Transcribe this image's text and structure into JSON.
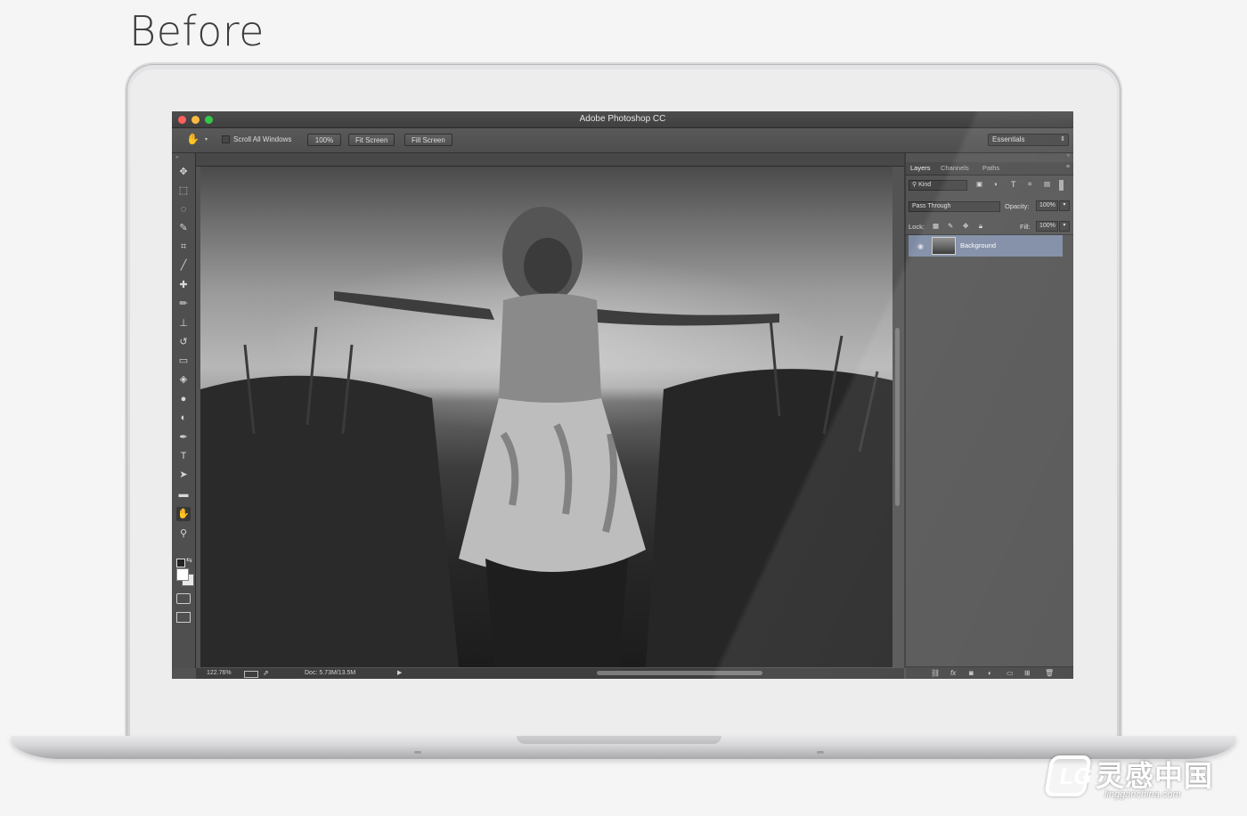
{
  "heading": "Before",
  "window": {
    "title": "Adobe Photoshop CC",
    "traffic_lights": {
      "close": "#fc605c",
      "minimize": "#fdbc40",
      "zoom": "#34c84a"
    }
  },
  "options_bar": {
    "tool_icon": "hand-icon",
    "scroll_all_windows": "Scroll All Windows",
    "zoom_100": "100%",
    "fit_screen": "Fit Screen",
    "fill_screen": "Fill Screen",
    "workspace": "Essentials"
  },
  "tools": [
    {
      "name": "move-tool",
      "glyph": "✥"
    },
    {
      "name": "rectangular-marquee-tool",
      "glyph": "⬚"
    },
    {
      "name": "lasso-tool",
      "glyph": "◌"
    },
    {
      "name": "quick-selection-tool",
      "glyph": "✎"
    },
    {
      "name": "crop-tool",
      "glyph": "⌗"
    },
    {
      "name": "eyedropper-tool",
      "glyph": "╱"
    },
    {
      "name": "healing-brush-tool",
      "glyph": "✚"
    },
    {
      "name": "brush-tool",
      "glyph": "✏"
    },
    {
      "name": "clone-stamp-tool",
      "glyph": "⊥"
    },
    {
      "name": "history-brush-tool",
      "glyph": "↺"
    },
    {
      "name": "eraser-tool",
      "glyph": "▭"
    },
    {
      "name": "paint-bucket-tool",
      "glyph": "◈"
    },
    {
      "name": "blur-tool",
      "glyph": "●"
    },
    {
      "name": "dodge-tool",
      "glyph": "◐"
    },
    {
      "name": "pen-tool",
      "glyph": "✒"
    },
    {
      "name": "type-tool",
      "glyph": "T"
    },
    {
      "name": "path-selection-tool",
      "glyph": "➤"
    },
    {
      "name": "rectangle-tool",
      "glyph": "▬"
    },
    {
      "name": "hand-tool",
      "glyph": "✋"
    },
    {
      "name": "zoom-tool",
      "glyph": "⚲"
    }
  ],
  "status_bar": {
    "zoom": "122.76%",
    "doc": "Doc: 5.73M/13.5M"
  },
  "layers_panel": {
    "tabs": [
      "Layers",
      "Channels",
      "Paths"
    ],
    "filter": "Kind",
    "blend_mode": "Pass Through",
    "opacity_label": "Opacity:",
    "opacity": "100%",
    "lock_label": "Lock:",
    "fill_label": "Fill:",
    "fill": "100%",
    "layers": [
      {
        "name": "Background",
        "selected": true,
        "selected_color": "#7d8aa3"
      }
    ],
    "bottom_icons": [
      "link-icon",
      "fx-icon",
      "mask-icon",
      "adjustment-icon",
      "folder-icon",
      "new-layer-icon",
      "trash-icon"
    ]
  },
  "watermark": {
    "logo_letters": "LG",
    "name": "灵感中国",
    "url": "lingganchina.com"
  }
}
